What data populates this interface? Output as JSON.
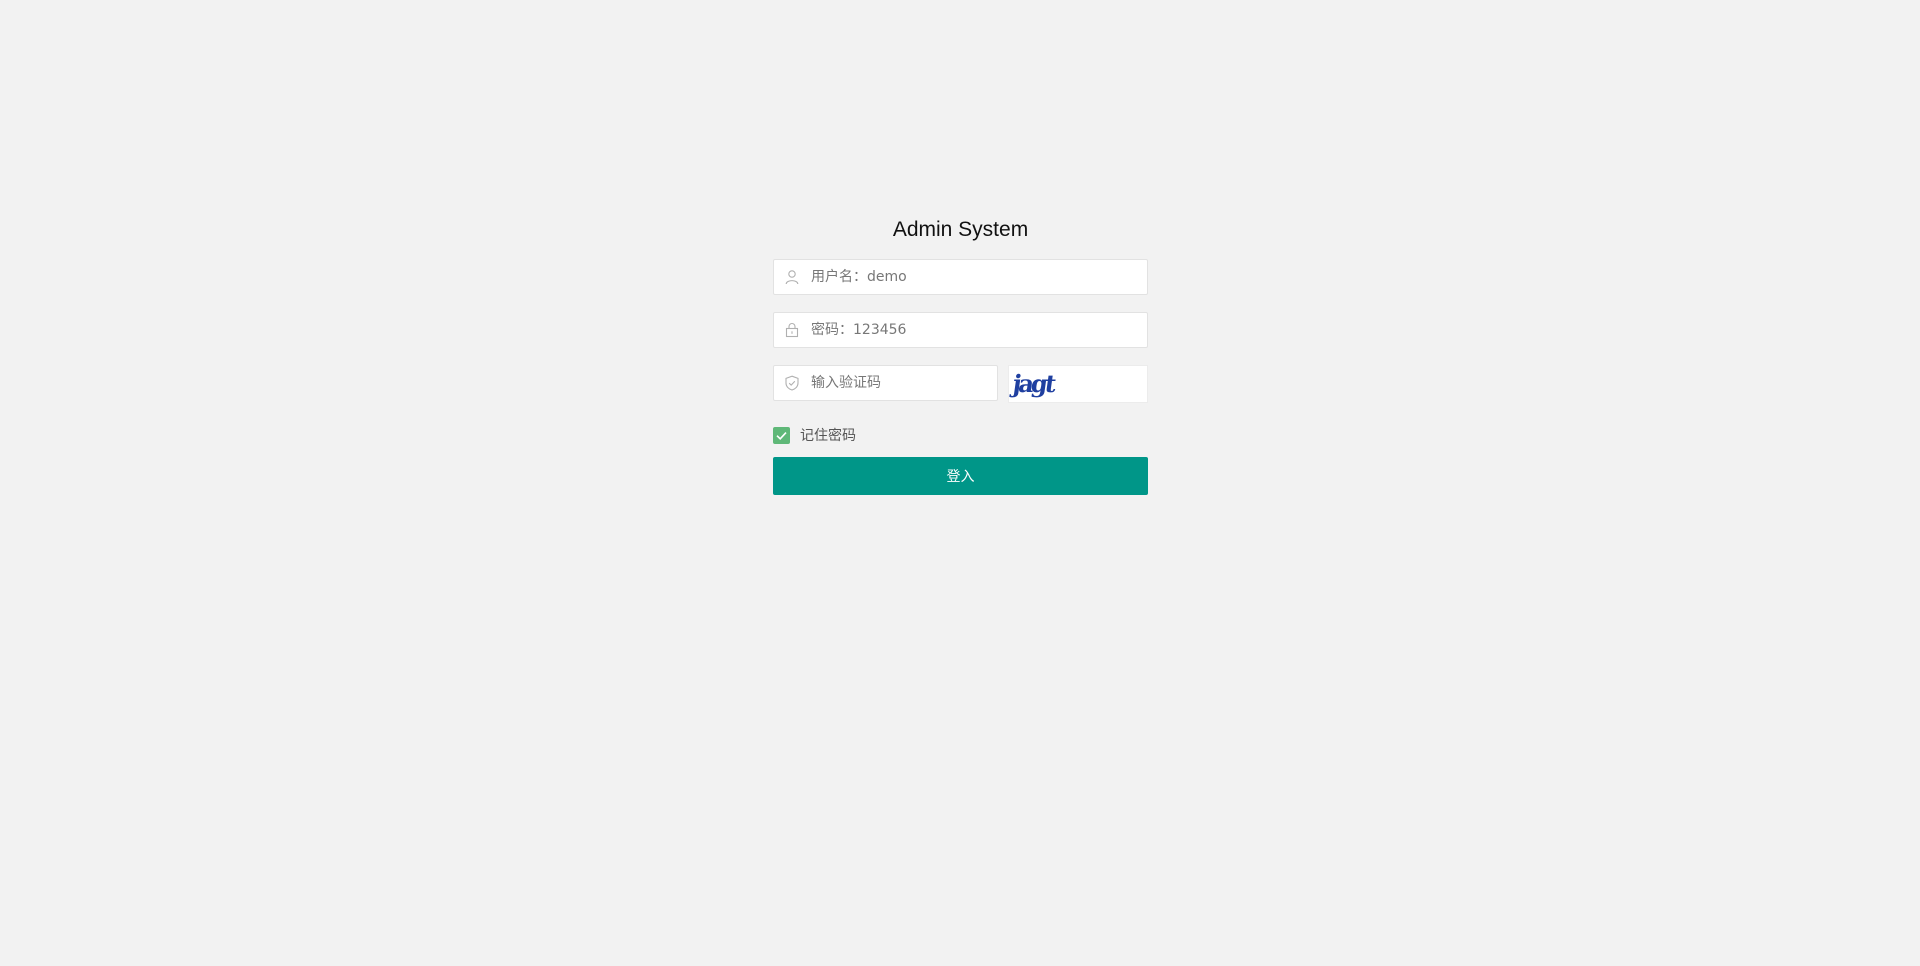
{
  "title": "Admin System",
  "form": {
    "username": {
      "placeholder": "用户名：demo",
      "value": "",
      "icon": "user-icon"
    },
    "password": {
      "placeholder": "密码：123456",
      "value": "",
      "icon": "lock-icon"
    },
    "captcha": {
      "placeholder": "输入验证码",
      "value": "",
      "icon": "shield-icon",
      "image_text": "jagt"
    },
    "remember": {
      "label": "记住密码",
      "checked": true
    },
    "submit_label": "登入"
  },
  "colors": {
    "background": "#f2f2f2",
    "primary": "#009688",
    "checkbox": "#5fb878",
    "captcha_text": "#1f3fa0"
  }
}
